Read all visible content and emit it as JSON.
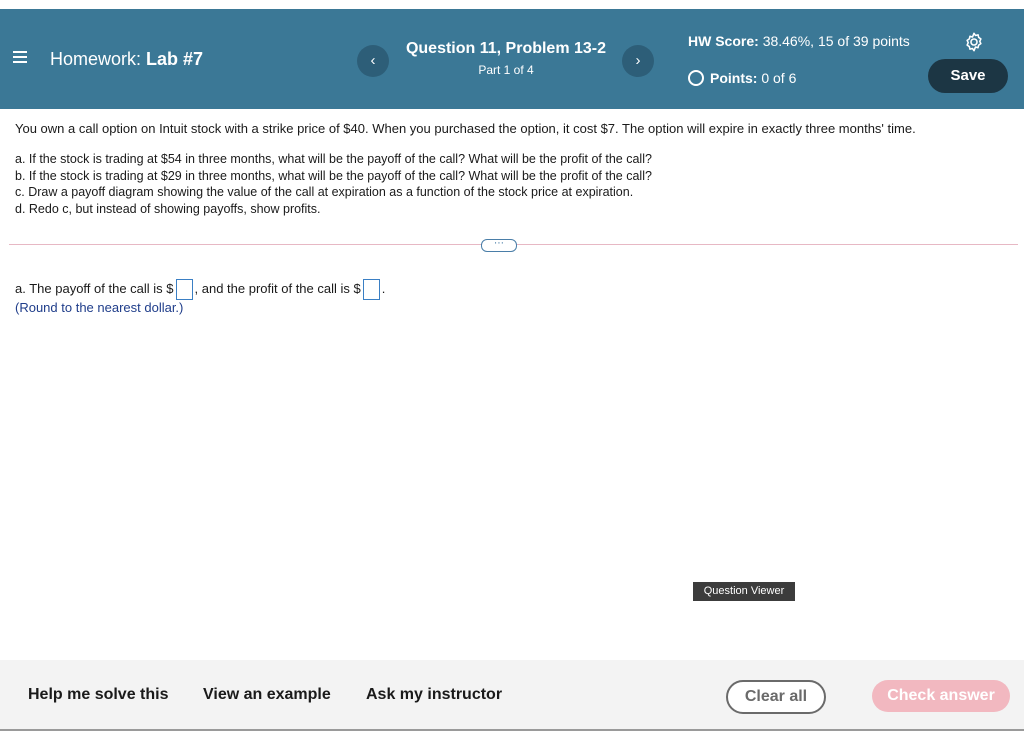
{
  "header": {
    "hw_prefix": "Homework:",
    "hw_name": "Lab #7",
    "question_title": "Question 11, Problem 13-2",
    "question_part": "Part 1 of 4",
    "score_label": "HW Score:",
    "score_value": "38.46%, 15 of 39 points",
    "points_label": "Points:",
    "points_value": "0 of 6",
    "save_label": "Save",
    "prev_glyph": "‹",
    "next_glyph": "›",
    "icons": {
      "menu": "hamburger-menu-icon",
      "settings": "gear-icon",
      "points_status": "empty-circle-icon"
    }
  },
  "problem": {
    "intro": "You own a call option on Intuit stock with a strike price of $40. When you purchased the option, it cost $7. The option will expire in exactly three months' time.",
    "parts": [
      "a. If the stock is trading at $54 in three months, what will be the payoff of the call? What will be the profit of the call?",
      "b. If the stock is trading at $29 in three months, what will be the payoff of the call? What will be the profit of the call?",
      "c. Draw a payoff diagram showing the value of the call at expiration as a function of the stock price at expiration.",
      "d. Redo c, but instead of showing payoffs, show profits."
    ],
    "more_glyph": "⋯"
  },
  "answer": {
    "prefix": "a. The payoff of the call is $",
    "middle": ", and the profit of the call is $",
    "suffix": ".",
    "payoff_value": "",
    "profit_value": "",
    "note": "(Round to the nearest dollar.)"
  },
  "question_viewer_label": "Question Viewer",
  "footer": {
    "help": "Help me solve this",
    "example": "View an example",
    "instructor": "Ask my instructor",
    "clear": "Clear all",
    "check": "Check answer"
  },
  "colors": {
    "header_bg": "#3b7896",
    "save_bg": "#1c3644",
    "check_answer_bg": "#f2b8c0",
    "note_text": "#1f3d8a",
    "answer_box_border": "#3a7fc4"
  }
}
